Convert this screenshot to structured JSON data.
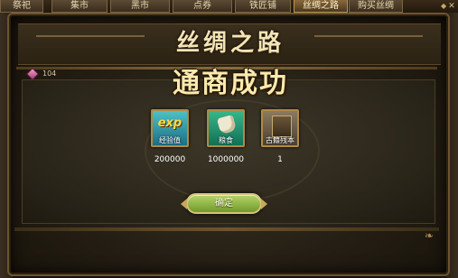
{
  "tabs": [
    {
      "label": "祭祀",
      "active": false
    },
    {
      "label": "集市",
      "active": false
    },
    {
      "label": "黑市",
      "active": false
    },
    {
      "label": "点券",
      "active": false
    },
    {
      "label": "铁匠铺",
      "active": false
    },
    {
      "label": "丝绸之路",
      "active": true
    },
    {
      "label": "购买丝绸",
      "active": false
    }
  ],
  "dialog": {
    "title": "丝绸之路",
    "success_text": "通商成功",
    "currency_value": "104",
    "confirm_label": "确定"
  },
  "rewards": [
    {
      "name": "经验值",
      "icon": "exp-icon",
      "icon_text": "exp",
      "quantity": "200000"
    },
    {
      "name": "粮食",
      "icon": "grain-sack-icon",
      "quantity": "1000000"
    },
    {
      "name": "古籍残本",
      "icon": "ancient-book-icon",
      "quantity": "1"
    }
  ],
  "colors": {
    "accent_gold": "#b08a44",
    "confirm_green": "#8fb446",
    "title_text": "#f3e3b6"
  }
}
